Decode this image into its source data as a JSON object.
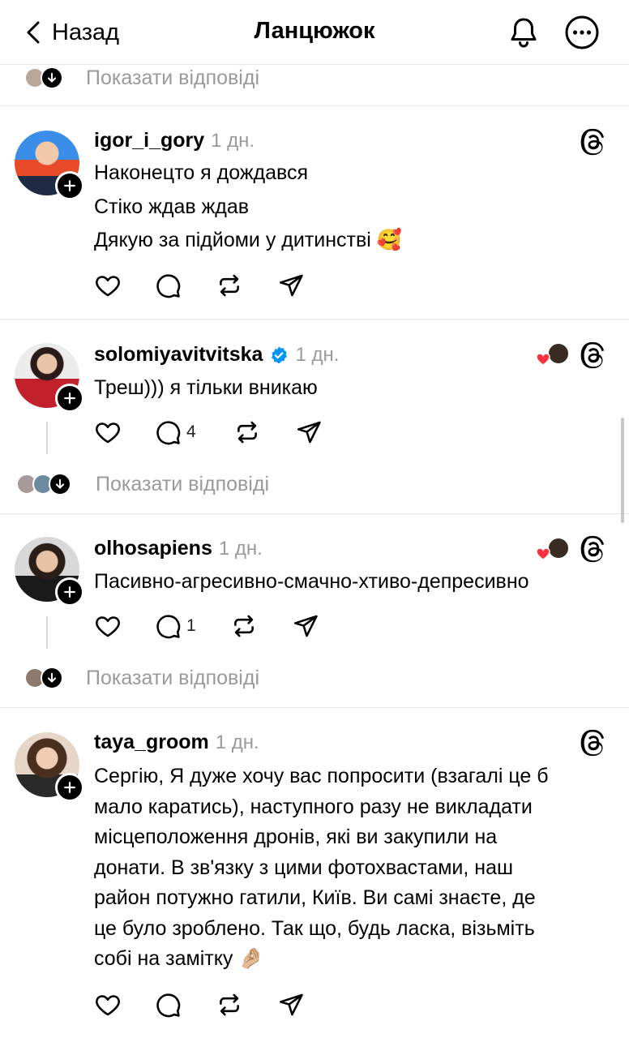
{
  "header": {
    "back_label": "Назад",
    "title": "Ланцюжок",
    "icons": [
      "chevron-left-icon",
      "bell-icon",
      "more-icon"
    ]
  },
  "show_replies_label": "Показати відповіді",
  "posts": [
    {
      "username": "igor_i_gory",
      "time": "1 дн.",
      "verified": false,
      "lines": [
        "Наконецто я дождався",
        "Стіко ждав ждав",
        "Дякую за підйоми у дитинстві 🥰"
      ],
      "reply_count": "",
      "liked_by_author": false
    },
    {
      "username": "solomiyavitvitska",
      "time": "1 дн.",
      "verified": true,
      "lines": [
        "Треш))) я тільки вникаю"
      ],
      "reply_count": "4",
      "liked_by_author": true
    },
    {
      "username": "olhosapiens",
      "time": "1 дн.",
      "verified": false,
      "lines": [
        "Пасивно-агресивно-смачно-хтиво-депресивно"
      ],
      "reply_count": "1",
      "liked_by_author": true
    },
    {
      "username": "taya_groom",
      "time": "1 дн.",
      "verified": false,
      "lines": [
        "Сергію, Я дуже хочу вас попросити (взагалі це б",
        "мало каратись), наступного разу не викладати",
        "місцеположення дронів, які ви закупили на",
        "донати. В зв'язку з цими фотохвастами, наш",
        "район потужно гатили, Київ. Ви самі знаєте, де",
        "це було зроблено. Так що, будь ласка, візьміть",
        "собі на замітку 🤌🏼"
      ],
      "reply_count": "",
      "liked_by_author": false
    }
  ],
  "colors": {
    "text": "#000000",
    "muted": "#9a9a9a",
    "divider": "#e6e6e6",
    "verified": "#0095f6",
    "heart": "#ff3040"
  }
}
